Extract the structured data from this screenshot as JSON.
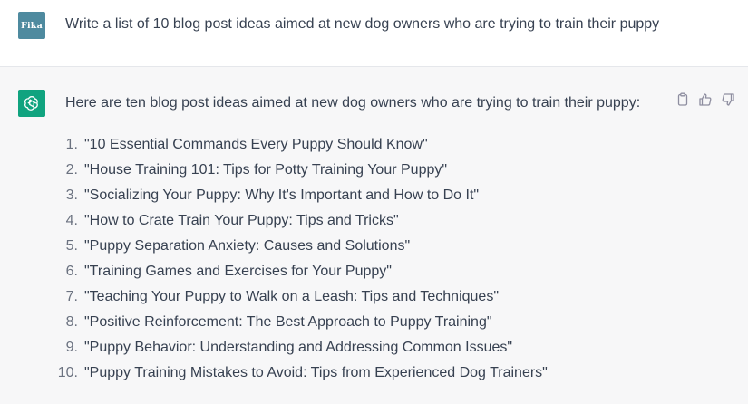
{
  "user": {
    "avatar_text": "Fika",
    "avatar_color": "#4e8a9f",
    "message": "Write a list of 10 blog post ideas aimed at new dog owners who are trying to train their puppy"
  },
  "assistant": {
    "avatar_icon": "openai-logo-icon",
    "avatar_color": "#10a37f",
    "intro": "Here are ten blog post ideas aimed at new dog owners who are trying to train their puppy:",
    "items": [
      {
        "num": "1.",
        "text": "\"10 Essential Commands Every Puppy Should Know\""
      },
      {
        "num": "2.",
        "text": "\"House Training 101: Tips for Potty Training Your Puppy\""
      },
      {
        "num": "3.",
        "text": "\"Socializing Your Puppy: Why It's Important and How to Do It\""
      },
      {
        "num": "4.",
        "text": "\"How to Crate Train Your Puppy: Tips and Tricks\""
      },
      {
        "num": "5.",
        "text": "\"Puppy Separation Anxiety: Causes and Solutions\""
      },
      {
        "num": "6.",
        "text": "\"Training Games and Exercises for Your Puppy\""
      },
      {
        "num": "7.",
        "text": "\"Teaching Your Puppy to Walk on a Leash: Tips and Techniques\""
      },
      {
        "num": "8.",
        "text": "\"Positive Reinforcement: The Best Approach to Puppy Training\""
      },
      {
        "num": "9.",
        "text": "\"Puppy Behavior: Understanding and Addressing Common Issues\""
      },
      {
        "num": "10.",
        "text": "\"Puppy Training Mistakes to Avoid: Tips from Experienced Dog Trainers\""
      }
    ]
  },
  "actions": {
    "icons": [
      "clipboard-icon",
      "thumbs-up-icon",
      "thumbs-down-icon"
    ]
  }
}
